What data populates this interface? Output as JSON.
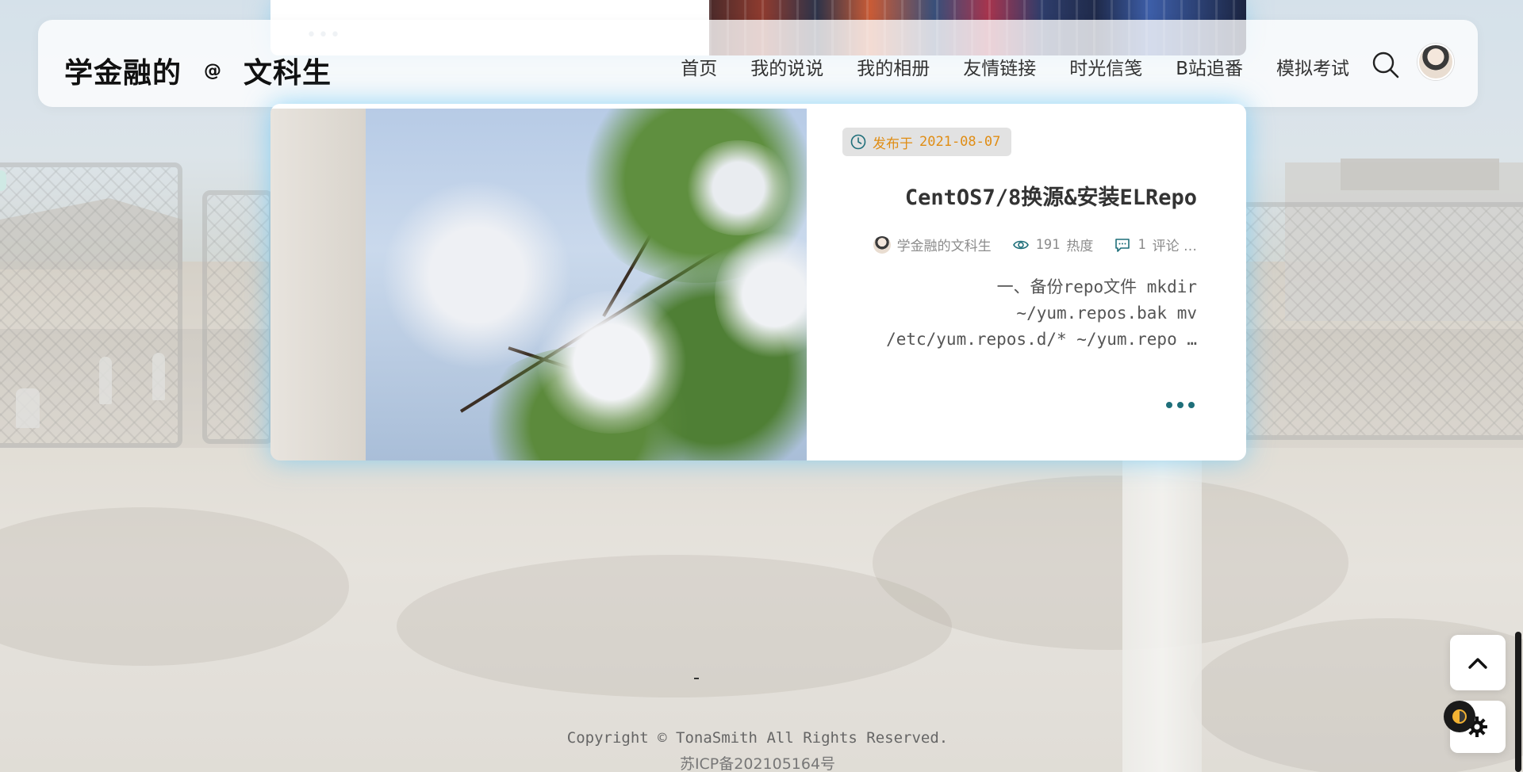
{
  "header": {
    "brand_part1": "学金融的",
    "brand_at": "@",
    "brand_part2": "文科生",
    "nav": [
      {
        "label": "首页"
      },
      {
        "label": "我的说说"
      },
      {
        "label": "我的相册"
      },
      {
        "label": "友情链接"
      },
      {
        "label": "时光信笺"
      },
      {
        "label": "B站追番"
      },
      {
        "label": "模拟考试"
      }
    ],
    "search_icon": "search-icon",
    "avatar_icon": "avatar"
  },
  "prev_card": {
    "dots": "•••"
  },
  "post": {
    "date_label": "发布于",
    "date": "2021-08-07",
    "title": "CentOS7/8换源&安装ELRepo",
    "author": "学金融的文科生",
    "views": "191",
    "views_label": "热度",
    "comments": "1",
    "comments_label": "评论 …",
    "excerpt_line1": "一、备份repo文件 mkdir",
    "excerpt_line2": "~/yum.repos.bak mv",
    "excerpt_line3": "/etc/yum.repos.d/* ~/yum.repo …",
    "colors": {
      "date_text": "#e08d14",
      "accent": "#1f6f7a",
      "glow": "#6ec8f5"
    }
  },
  "footer": {
    "copyright": "Copyright © TonaSmith All Rights Reserved.",
    "icp": "苏ICP备202105164号"
  },
  "controls": {
    "back_to_top_icon": "chevron-up-icon",
    "theme_icon": "theme-toggle-icon",
    "settings_icon": "gear-icon"
  }
}
